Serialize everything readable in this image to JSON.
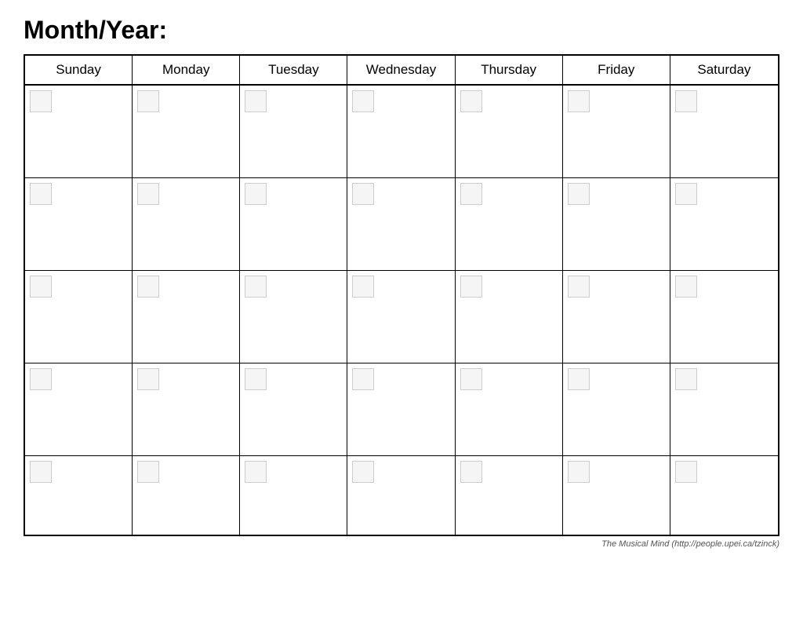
{
  "header": {
    "title": "Month/Year:"
  },
  "calendar": {
    "days": [
      "Sunday",
      "Monday",
      "Tuesday",
      "Wednesday",
      "Thursday",
      "Friday",
      "Saturday"
    ],
    "rows": 5
  },
  "footer": {
    "credit": "The Musical Mind  (http://people.upei.ca/tzinck)"
  }
}
